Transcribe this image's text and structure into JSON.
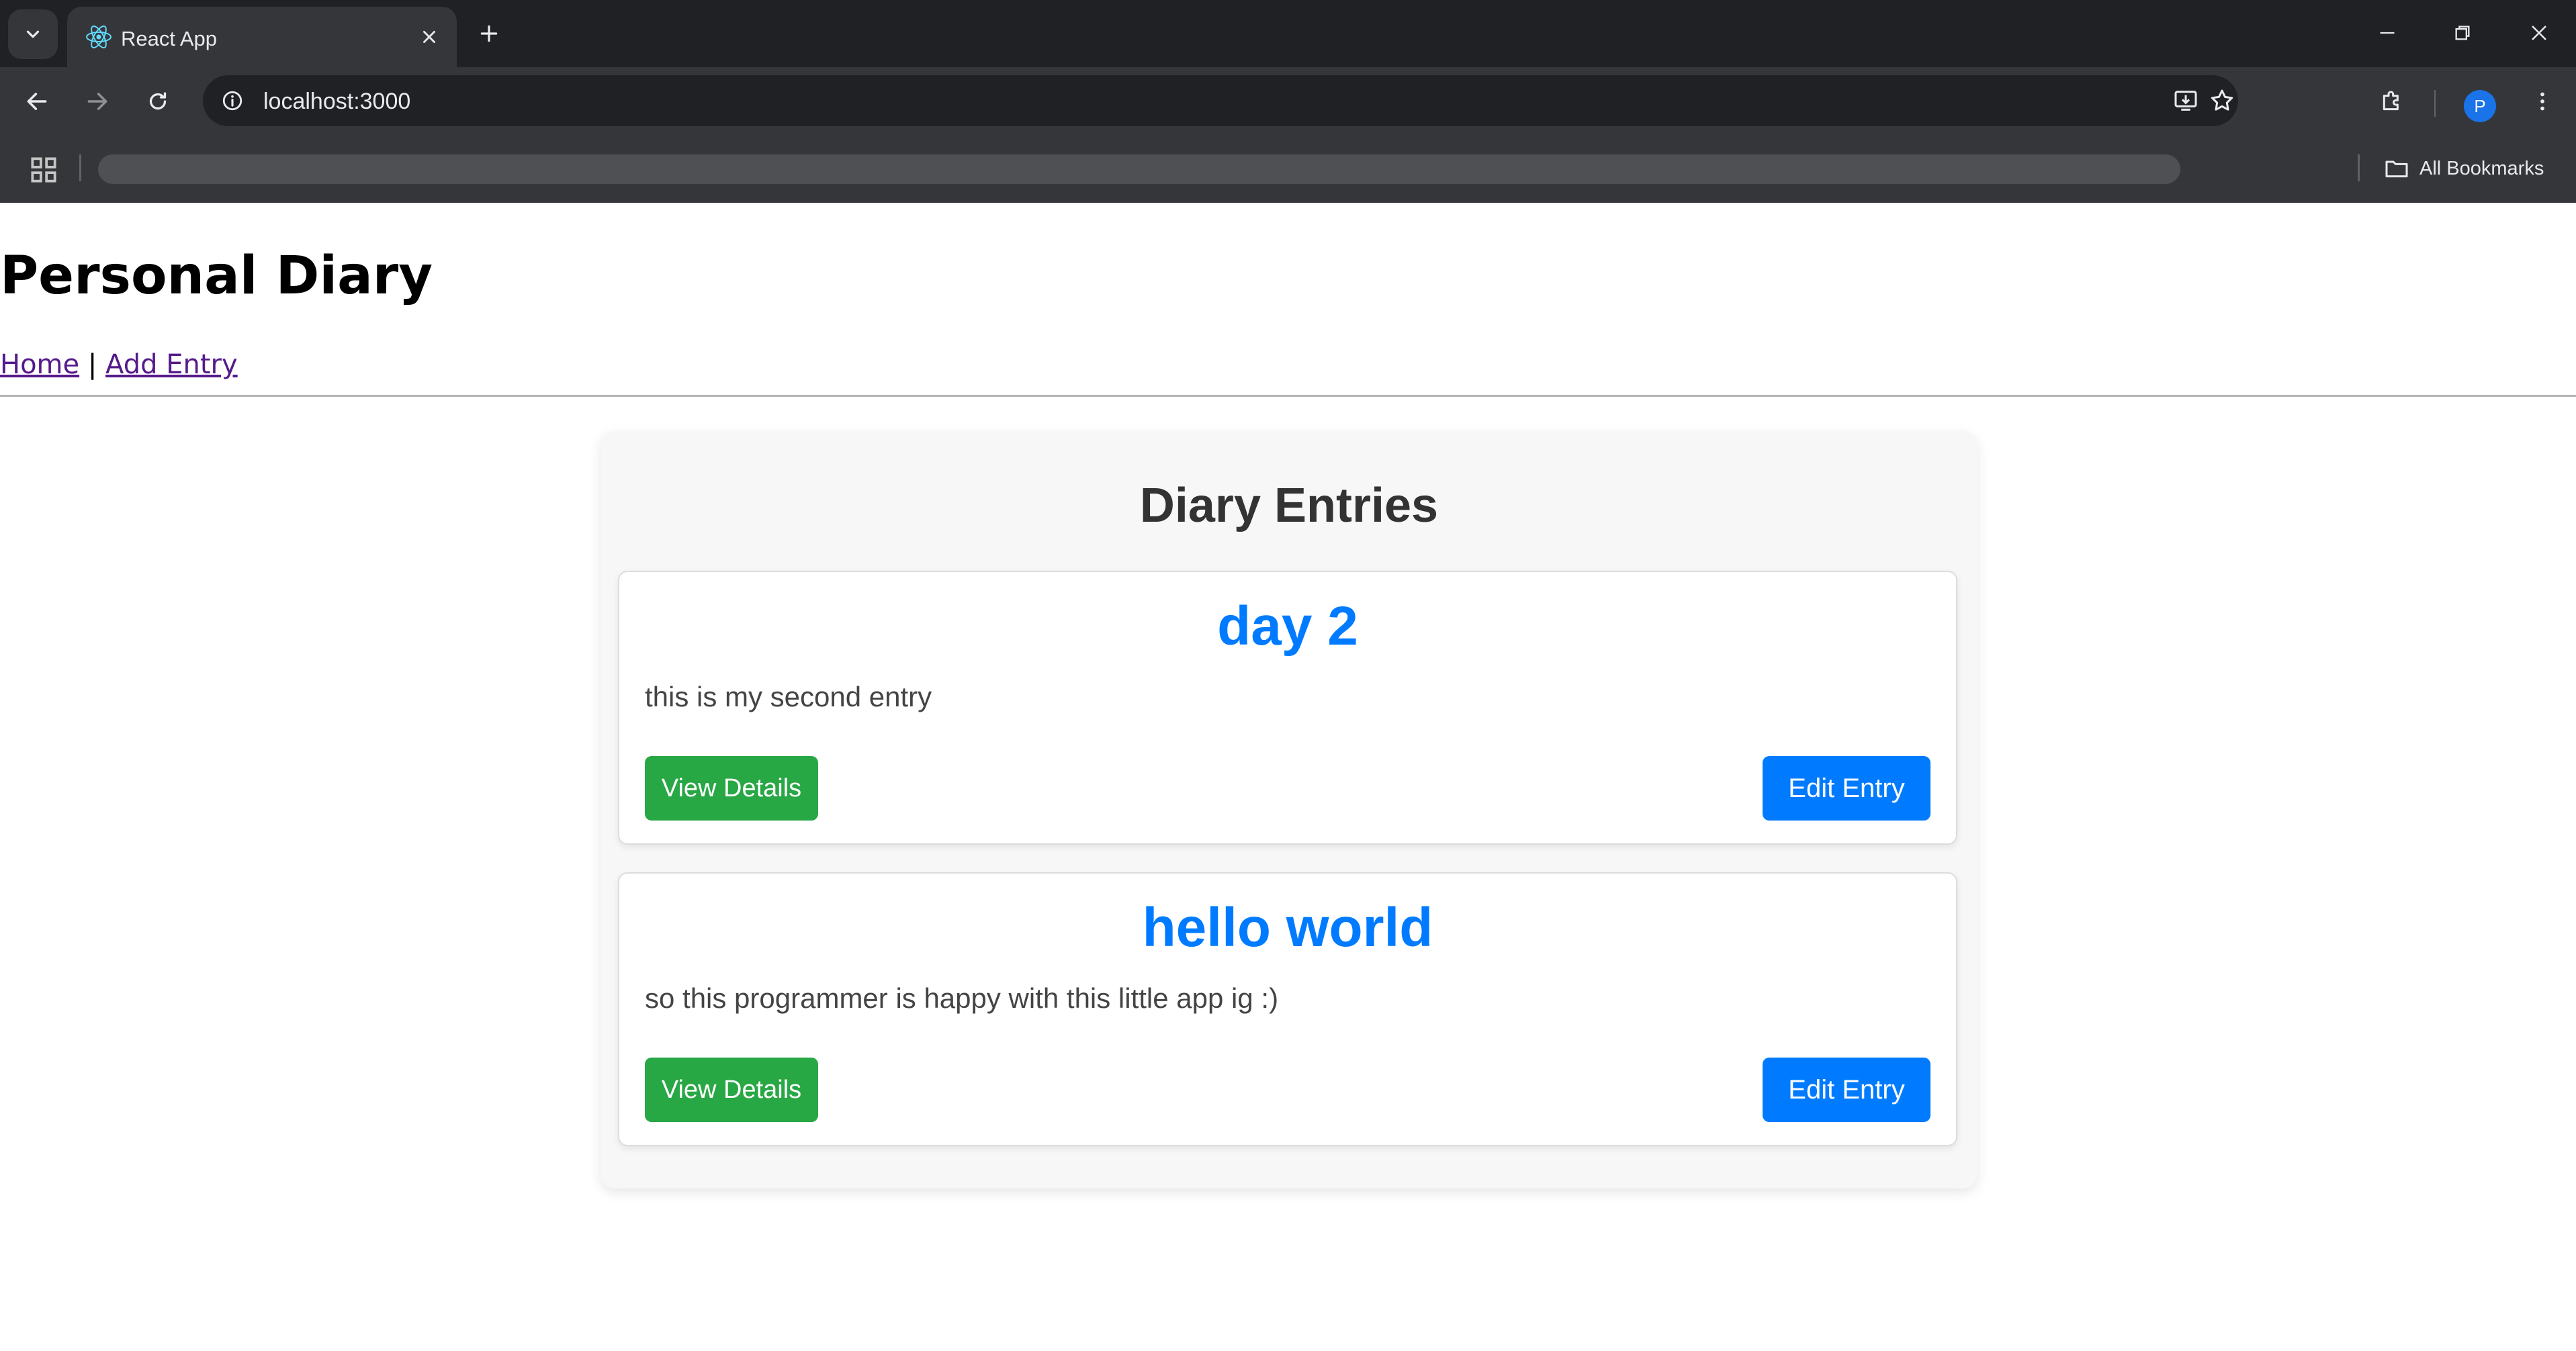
{
  "browser": {
    "tab_title": "React App",
    "url": "localhost:3000",
    "all_bookmarks_label": "All Bookmarks",
    "profile_initial": "P"
  },
  "app": {
    "title": "Personal Diary",
    "nav": {
      "home": "Home",
      "separator": "|",
      "add_entry": "Add Entry"
    }
  },
  "list": {
    "heading": "Diary Entries",
    "entries": [
      {
        "title": "day 2",
        "content": "this is my second entry",
        "view_label": "View Details",
        "edit_label": "Edit Entry"
      },
      {
        "title": "hello world",
        "content": "so this programmer is happy with this little app ig :)",
        "view_label": "View Details",
        "edit_label": "Edit Entry"
      }
    ]
  },
  "colors": {
    "title_blue": "#007bff",
    "view_green": "#28a745",
    "edit_blue": "#007bff"
  }
}
